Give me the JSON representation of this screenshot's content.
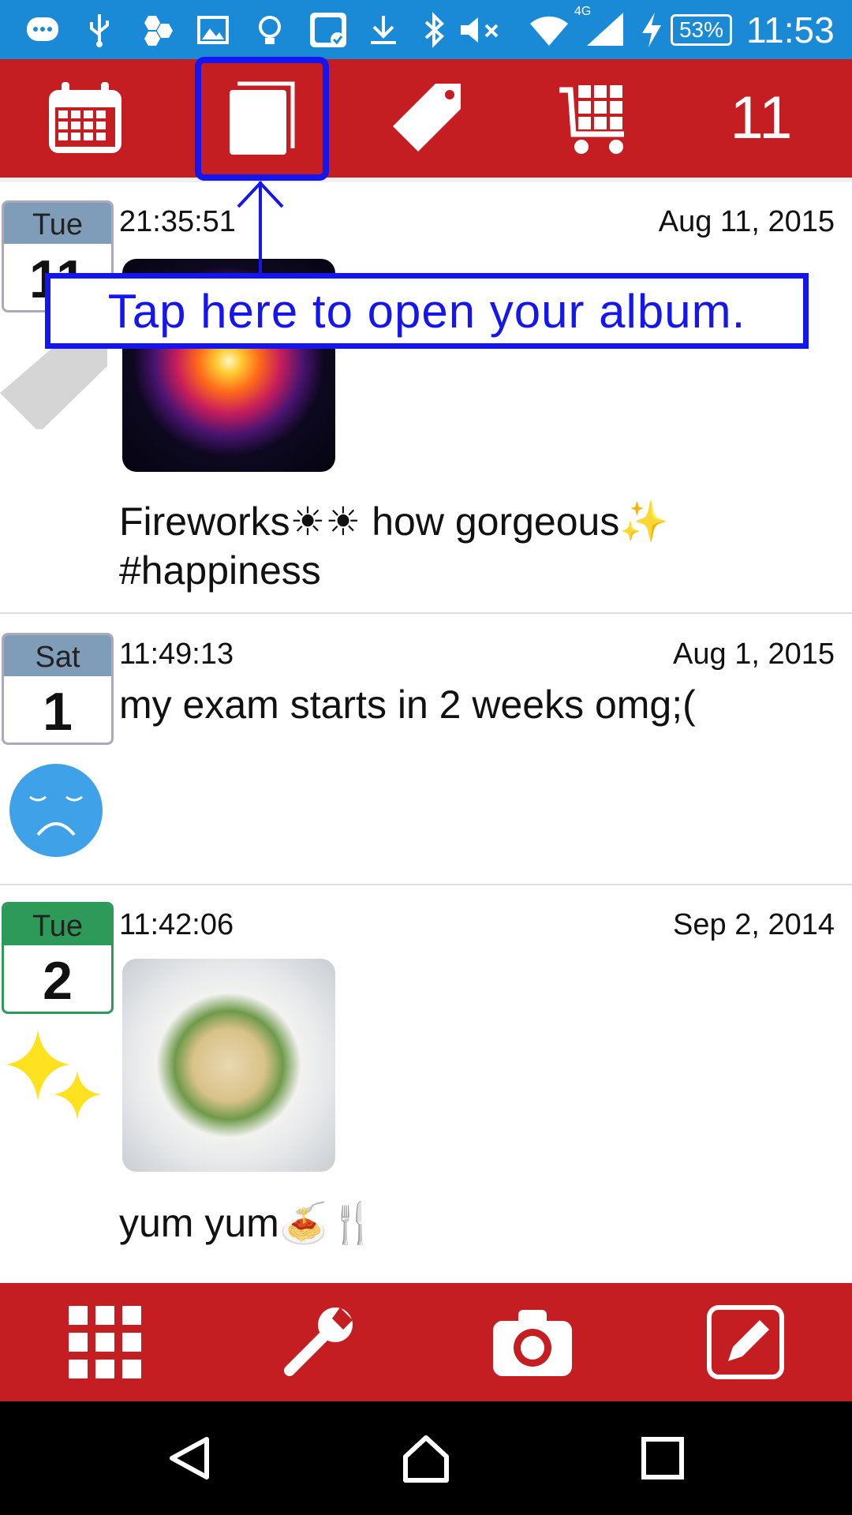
{
  "status_bar": {
    "battery": "53%",
    "time": "11:53",
    "network": "4G",
    "icons": [
      "message-icon",
      "usb-icon",
      "hexagon-icon",
      "image-icon",
      "bulb-icon",
      "app-notify-icon",
      "download-icon",
      "bluetooth-icon",
      "mute-icon",
      "wifi-icon",
      "signal-icon",
      "charging-icon"
    ]
  },
  "top_bar": {
    "buttons": [
      "calendar-icon",
      "album-icon",
      "tag-icon",
      "cart-grid-icon"
    ],
    "count": "11",
    "accent": "#c41e22"
  },
  "tutorial": {
    "callout_text": "Tap here to open your album.",
    "highlight_color": "#1515f0"
  },
  "entries": [
    {
      "dow": "Tue",
      "day": "11",
      "time": "21:35:51",
      "date": "Aug 11, 2015",
      "text_line1": "Fireworks☀☀ how gorgeous✨",
      "text_line2": "#happiness",
      "photo": "fireworks-photo",
      "mood_icon": "tag-icon",
      "badge_color": "#7f9cb8"
    },
    {
      "dow": "Sat",
      "day": "1",
      "time": "11:49:13",
      "date": "Aug 1, 2015",
      "text_line1": "my exam starts in 2 weeks omg;(",
      "mood_icon": "sad-face-icon",
      "badge_color": "#7f9cb8"
    },
    {
      "dow": "Tue",
      "day": "2",
      "time": "11:42:06",
      "date": "Sep 2, 2014",
      "text_line1": "yum yum🍝🍴",
      "photo": "pasta-photo",
      "mood_icon": "sparkle-icon",
      "badge_color": "#2e9a5a"
    }
  ],
  "bottom_bar": {
    "buttons": [
      "grid-icon",
      "wrench-icon",
      "camera-icon",
      "edit-icon"
    ]
  },
  "nav_bar": {
    "buttons": [
      "back-icon",
      "home-icon",
      "recents-icon"
    ]
  }
}
